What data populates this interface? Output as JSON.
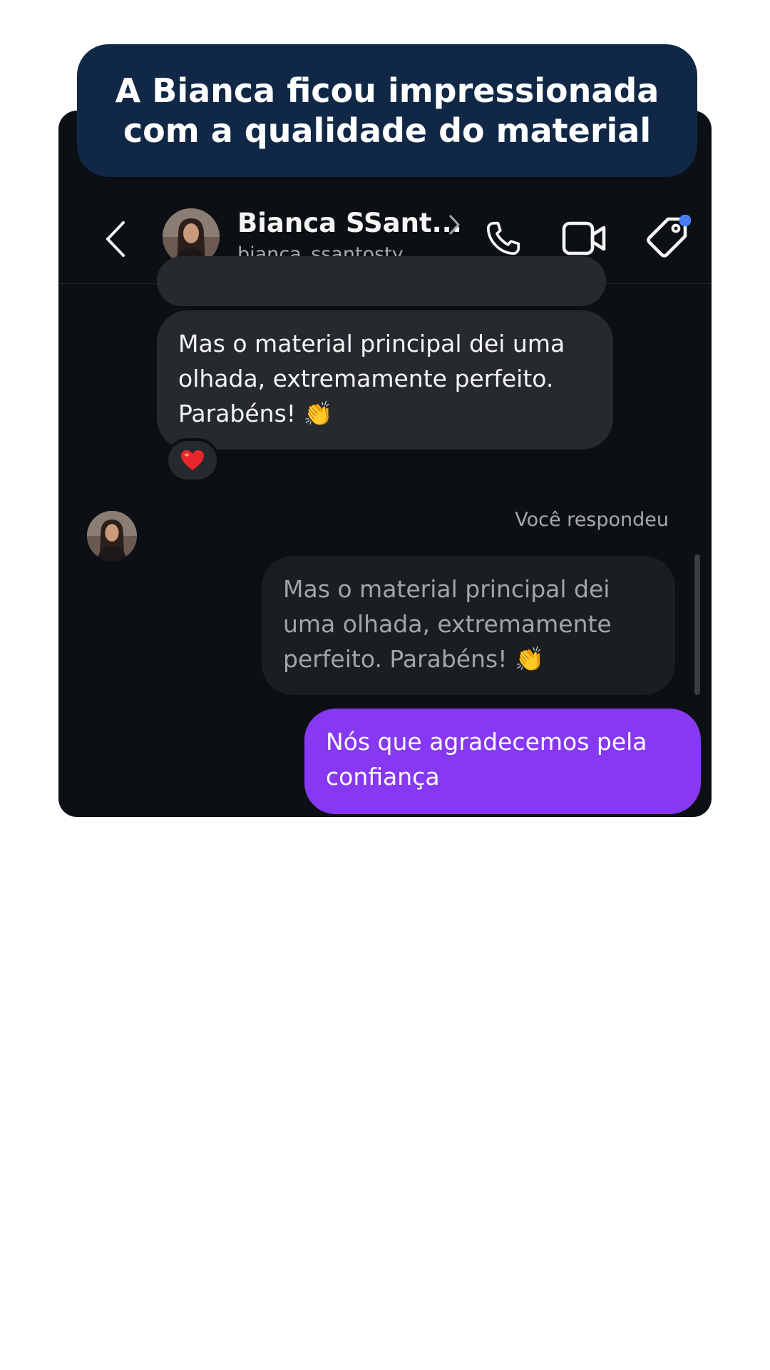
{
  "headline": {
    "line1": "A Bianca ficou impressionada",
    "line2": "com a qualidade do material",
    "background": "#102846"
  },
  "chat": {
    "contact_name": "Bianca SSant...",
    "contact_username": "bianca_ssantosty",
    "background": "#0c1014",
    "icons": [
      "back-icon",
      "avatar",
      "chevron-right-icon",
      "phone-icon",
      "video-camera-icon",
      "tag-icon"
    ],
    "tag_dot_color": "#4a7cf6"
  },
  "messages": {
    "incoming_text": "Mas o material principal dei uma olhada, extremamente perfeito. Parabéns! 👏",
    "reaction": "❤️",
    "replied_label": "Você respondeu",
    "quoted_text": "Mas o material principal dei uma olhada, extremamente perfeito. Parabéns! 👏",
    "outgoing_text": "Nós que agradecemos pela confiança",
    "outgoing_color": "#8638f3",
    "incoming_color": "#26292d"
  }
}
